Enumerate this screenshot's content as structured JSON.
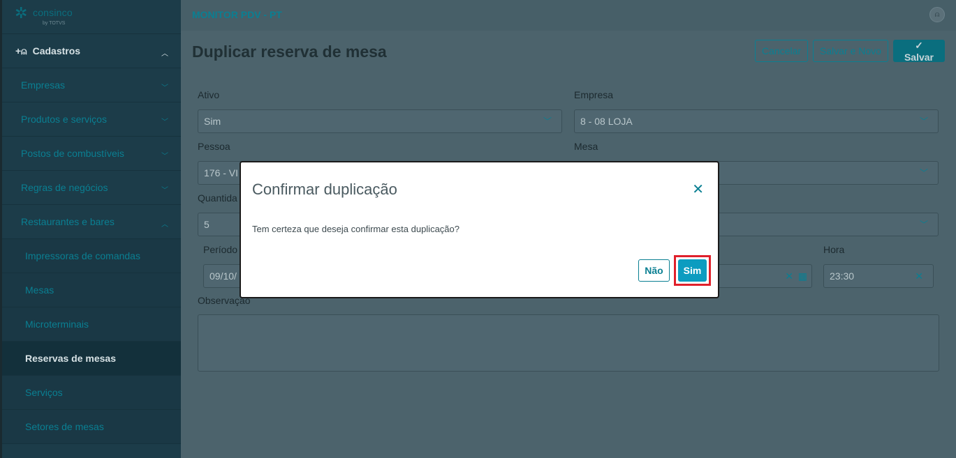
{
  "sidebar": {
    "brand": "consinco",
    "brand_by": "by TOTVS",
    "section_label": "Cadastros",
    "items": [
      {
        "label": "Empresas"
      },
      {
        "label": "Produtos e serviços"
      },
      {
        "label": "Postos de combustíveis"
      },
      {
        "label": "Regras de negócios"
      },
      {
        "label": "Restaurantes e bares"
      }
    ],
    "subitems": [
      {
        "label": "Impressoras de comandas"
      },
      {
        "label": "Mesas"
      },
      {
        "label": "Microterminais"
      },
      {
        "label": "Reservas de mesas"
      },
      {
        "label": "Serviços"
      },
      {
        "label": "Setores de mesas"
      }
    ]
  },
  "header": {
    "app_title": "MONITOR PDV - PT"
  },
  "page": {
    "title": "Duplicar reserva de mesa",
    "cancel_label": "Cancelar",
    "save_new_label": "Salvar e Novo",
    "save_label": "Salvar"
  },
  "form": {
    "ativo_label": "Ativo",
    "ativo_value": "Sim",
    "empresa_label": "Empresa",
    "empresa_value": "8 - 08 LOJA",
    "pessoa_label": "Pessoa",
    "pessoa_value": "176 - VI",
    "mesa_label": "Mesa",
    "quantidade_label": "Quantida",
    "quantidade_value": "5",
    "periodo_label": "Período",
    "periodo_value": "09/10/",
    "hora_label": "Hora",
    "hora_value": "23:30",
    "observacao_label": "Observação"
  },
  "modal": {
    "title": "Confirmar duplicação",
    "message": "Tem certeza que deseja confirmar esta duplicação?",
    "no_label": "Não",
    "yes_label": "Sim"
  }
}
